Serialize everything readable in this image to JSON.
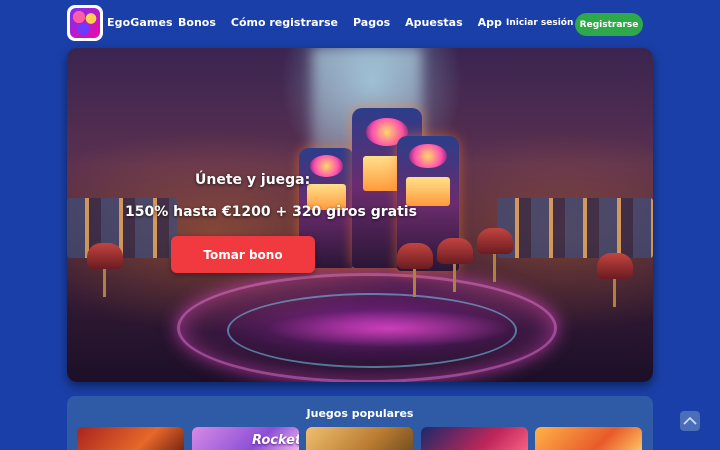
{
  "header": {
    "brand": "EgoGames",
    "nav": [
      "Bonos",
      "Cómo registrarse",
      "Pagos",
      "Apuestas",
      "App"
    ],
    "login_label": "Iniciar sesión",
    "register_label": "Registrarse"
  },
  "hero": {
    "line1": "Únete y juega:",
    "line2": "150% hasta €1200 + 320 giros gratis",
    "cta_label": "Tomar bono"
  },
  "popular": {
    "title": "Juegos populares",
    "games": [
      {
        "label": ""
      },
      {
        "label": "Rocket"
      },
      {
        "label": ""
      },
      {
        "label": ""
      },
      {
        "label": ""
      }
    ]
  },
  "icons": {
    "scroll_top": "chevron-up-icon",
    "logo": "app-logo-icon"
  },
  "colors": {
    "background": "#1a3fa8",
    "register_button": "#2fa84a",
    "cta_button": "#f03a3f",
    "games_panel": "#2e5aa6"
  }
}
